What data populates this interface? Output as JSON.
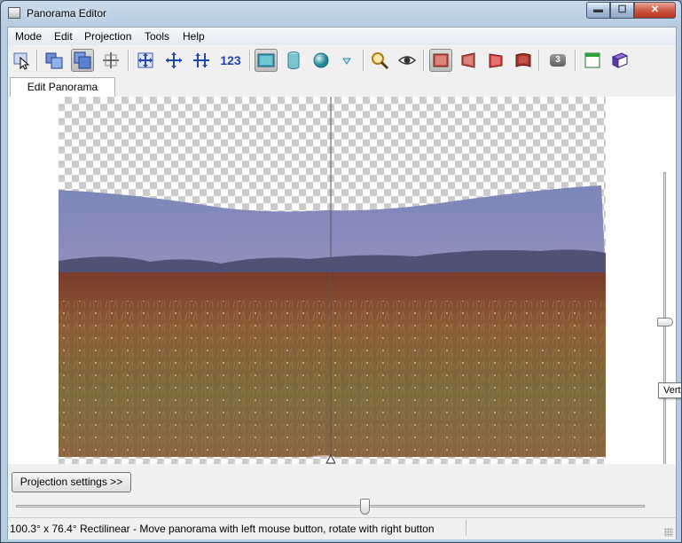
{
  "window": {
    "title": "Panorama Editor",
    "min_glyph": "▬",
    "max_glyph": "☐",
    "close_glyph": "✕"
  },
  "menu": [
    "Mode",
    "Edit",
    "Projection",
    "Tools",
    "Help"
  ],
  "toolbar": {
    "numbers_label": "123",
    "badge_label": "3",
    "icons": [
      "select-icon",
      "preview-icon",
      "layout-icon",
      "crosshair-icon",
      "fit-icon",
      "center-icon",
      "straighten-icon",
      "rectilinear-icon",
      "cylinder-icon",
      "sphere-icon",
      "dropdown-icon",
      "zoom-icon",
      "eye-icon",
      "flat-image-icon",
      "tilted-image-icon",
      "tilted-image-2-icon",
      "curved-image-icon",
      "window-icon",
      "book-icon"
    ]
  },
  "tabs": [
    {
      "label": "Edit Panorama",
      "active": true
    }
  ],
  "vertical_slider": {
    "value": 0.35
  },
  "tooltip": {
    "text": "Verti"
  },
  "projection_button": "Projection settings >>",
  "horizontal_slider": {
    "value": 0.56
  },
  "status": {
    "text": "100.3° x 76.4° Rectilinear - Move panorama with left mouse button, rotate with right button"
  },
  "colors": {
    "accent": "#3e6fb0",
    "close_red": "#c84630"
  }
}
